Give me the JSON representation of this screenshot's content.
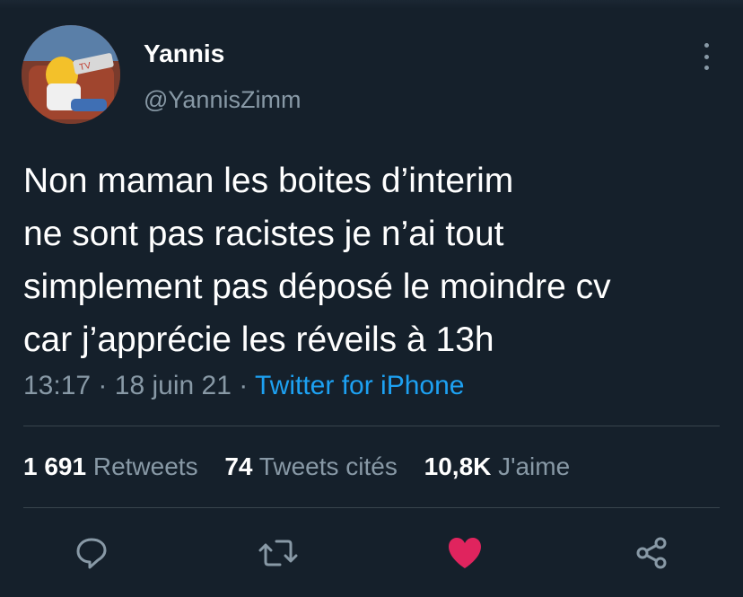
{
  "user": {
    "name": "Yannis",
    "handle": "@YannisZimm",
    "avatar_sign_text": "TV"
  },
  "tweet": {
    "lines": [
      "Non maman les boites d’interim",
      "ne sont pas racistes je n’ai tout",
      "simplement pas déposé le moindre cv",
      "car j’apprécie les réveils à 13h"
    ]
  },
  "meta": {
    "time": "13:17",
    "separator": "·",
    "date": "18 juin 21",
    "source": "Twitter for iPhone"
  },
  "stats": {
    "retweets_count": "1 691",
    "retweets_label": "Retweets",
    "quotes_count": "74",
    "quotes_label": "Tweets cités",
    "likes_count": "10,8K",
    "likes_label": "J'aime"
  },
  "icons": {
    "more": "more-vertical-icon",
    "reply": "reply-icon",
    "retweet": "retweet-icon",
    "like": "heart-icon",
    "share": "share-icon"
  },
  "colors": {
    "background": "#15202b",
    "secondary_text": "#8899a6",
    "link": "#1da1f2",
    "like": "#e0245e",
    "divider": "#38444d"
  }
}
